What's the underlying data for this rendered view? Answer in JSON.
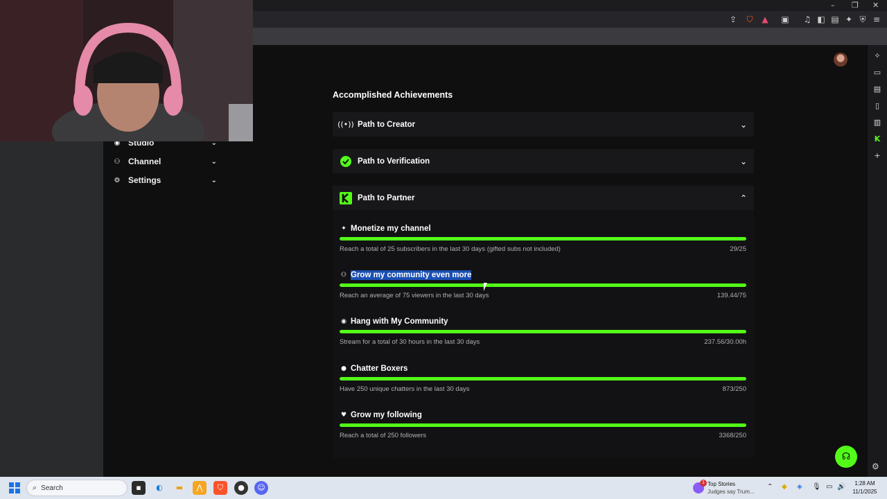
{
  "browser": {
    "window_controls": [
      "–",
      "❐",
      "✕"
    ]
  },
  "sidebar": {
    "items": [
      {
        "label": "Studio",
        "icon": "studio-icon"
      },
      {
        "label": "Channel",
        "icon": "channel-icon"
      },
      {
        "label": "Settings",
        "icon": "gear-icon"
      }
    ]
  },
  "achievements": {
    "title": "Accomplished Achievements",
    "sections": [
      {
        "label": "Path to Creator",
        "icon": "broadcast-icon",
        "expanded": false
      },
      {
        "label": "Path to Verification",
        "icon": "verified-badge-icon",
        "expanded": false
      },
      {
        "label": "Path to Partner",
        "icon": "kick-logo-icon",
        "expanded": true
      }
    ],
    "goals": [
      {
        "title": "Monetize my channel",
        "icon": "sparkle-icon",
        "desc": "Reach a total of 25 subscribers in the last 30 days (gifted subs not included)",
        "value": "29/25",
        "progress": 1.0
      },
      {
        "title": "Grow my community even more",
        "icon": "users-icon",
        "desc": "Reach an average of 75 viewers in the last 30 days",
        "value": "139.44/75",
        "progress": 1.0,
        "selected": true
      },
      {
        "title": "Hang with My Community",
        "icon": "broadcast-icon",
        "desc": "Stream for a total of 30 hours in the last 30 days",
        "value": "237.56/30.00h",
        "progress": 1.0
      },
      {
        "title": "Chatter Boxers",
        "icon": "chat-icon",
        "desc": "Have 250 unique chatters in the last 30 days",
        "value": "873/250",
        "progress": 1.0
      },
      {
        "title": "Grow my following",
        "icon": "heart-icon",
        "desc": "Reach a total of 250 followers",
        "value": "3368/250",
        "progress": 1.0
      }
    ]
  },
  "taskbar": {
    "search_placeholder": "Search",
    "news_badge": "1",
    "news_title": "Top Stories",
    "news_sub": "Judges say Trum...",
    "time": "1:28 AM",
    "date": "11/1/2025"
  },
  "colors": {
    "accent": "#53fc18",
    "selection": "#1a4fb3",
    "background": "#0f0f10"
  }
}
